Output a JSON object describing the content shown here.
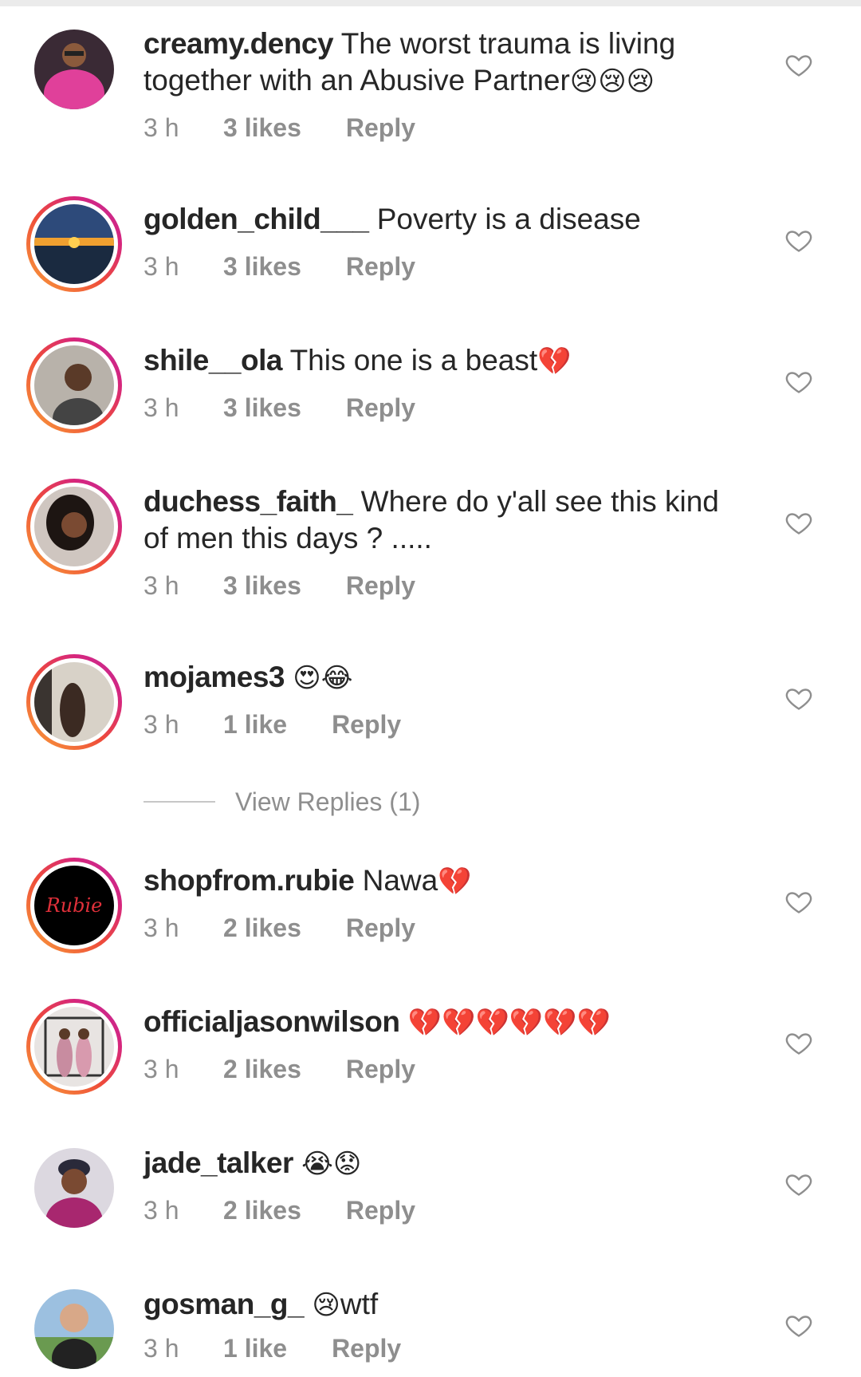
{
  "view_replies_label": "View Replies (1)",
  "colors": {
    "ring_start": "#f9a23a",
    "ring_end": "#c22a9b",
    "meta_gray": "#8e8e8e",
    "text": "#262626"
  },
  "comments": [
    {
      "username": "creamy.dency",
      "text": "The worst trauma is living together with an Abusive Partner",
      "emoji": "😢😢😢",
      "time": "3 h",
      "likes": "3 likes",
      "reply": "Reply",
      "story_ring": false,
      "avatar_icon": "avatar-icon"
    },
    {
      "username": "golden_child___",
      "text": "Poverty is a disease",
      "emoji": "",
      "time": "3 h",
      "likes": "3 likes",
      "reply": "Reply",
      "story_ring": true,
      "avatar_icon": "avatar-icon"
    },
    {
      "username": "shile__ola",
      "text": "This one is a beast",
      "emoji": "💔",
      "time": "3 h",
      "likes": "3 likes",
      "reply": "Reply",
      "story_ring": true,
      "avatar_icon": "avatar-icon"
    },
    {
      "username": "duchess_faith_",
      "text": "Where do y'all see this kind of men this days ? .....",
      "emoji": "",
      "time": "3 h",
      "likes": "3 likes",
      "reply": "Reply",
      "story_ring": true,
      "avatar_icon": "avatar-icon"
    },
    {
      "username": "mojames3",
      "text": "",
      "emoji": "😍😂",
      "time": "3 h",
      "likes": "1 like",
      "reply": "Reply",
      "story_ring": true,
      "avatar_icon": "avatar-icon"
    },
    {
      "username": "shopfrom.rubie",
      "text": "Nawa",
      "emoji": "💔",
      "time": "3 h",
      "likes": "2 likes",
      "reply": "Reply",
      "story_ring": true,
      "avatar_icon": "avatar-icon",
      "avatar_logo": "Rubie"
    },
    {
      "username": "officialjasonwilson",
      "text": "",
      "emoji": "💔💔💔💔💔💔",
      "time": "3 h",
      "likes": "2 likes",
      "reply": "Reply",
      "story_ring": true,
      "avatar_icon": "avatar-icon"
    },
    {
      "username": "jade_talker",
      "text": "",
      "emoji": "😭😟",
      "time": "3 h",
      "likes": "2 likes",
      "reply": "Reply",
      "story_ring": false,
      "avatar_icon": "avatar-icon"
    },
    {
      "username": "gosman_g_",
      "text": "wtf",
      "emoji": "😢",
      "emoji_first": true,
      "time": "3 h",
      "likes": "1 like",
      "reply": "Reply",
      "story_ring": false,
      "avatar_icon": "avatar-icon"
    }
  ]
}
